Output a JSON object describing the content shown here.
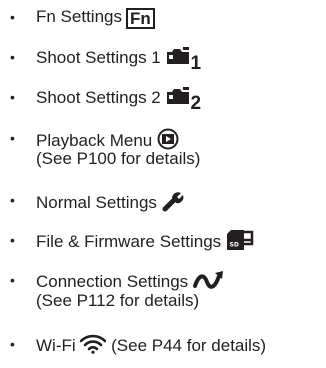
{
  "items": [
    {
      "label": "Fn Settings",
      "icon_text": "Fn",
      "icon": "fn-icon"
    },
    {
      "label": "Shoot Settings 1",
      "icon": "camera-icon",
      "icon_number": "1"
    },
    {
      "label": "Shoot Settings 2",
      "icon": "camera-icon",
      "icon_number": "2"
    },
    {
      "label": "Playback Menu",
      "icon": "playback-icon",
      "note": "(See P100 for details)"
    },
    {
      "label": "Normal Settings",
      "icon": "wrench-icon"
    },
    {
      "label": "File & Firmware Settings",
      "icon": "sd-card-icon"
    },
    {
      "label": "Connection Settings",
      "icon": "connection-icon",
      "note": "(See P112 for details)"
    },
    {
      "label": "Wi-Fi",
      "icon": "wifi-icon",
      "note": "(See P44 for details)"
    }
  ],
  "bullet": "•"
}
